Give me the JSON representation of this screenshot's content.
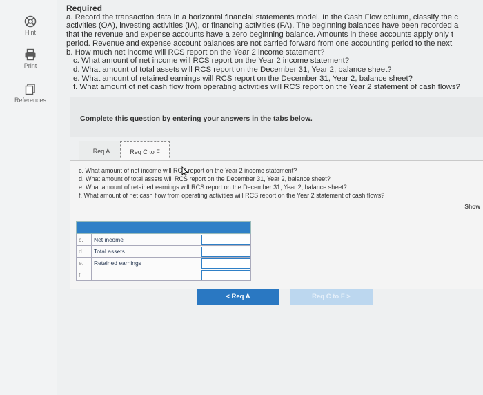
{
  "sidebar": {
    "items": [
      {
        "label": "Hint",
        "icon": "hint-icon"
      },
      {
        "label": "Print",
        "icon": "print-icon"
      },
      {
        "label": "References",
        "icon": "references-icon"
      }
    ]
  },
  "required": {
    "heading": "Required",
    "line_a1": "a. Record the transaction data in a horizontal financial statements model. In the Cash Flow column, classify the c",
    "line_a2": "activities (OA), investing activities (IA), or financing activities (FA). The beginning balances have been recorded a",
    "line_a3": "that the revenue and expense accounts have a zero beginning balance. Amounts in these accounts apply only t",
    "line_a4": "period. Revenue and expense account balances are not carried forward from one accounting period to the next",
    "line_a5": "b. How much net income will RCS report on the Year 2 income statement?",
    "line_c": "c. What amount of net income will RCS report on the Year 2 income statement?",
    "line_d": "d. What amount of total assets will RCS report on the December 31, Year 2, balance sheet?",
    "line_e": "e. What amount of retained earnings will RCS report on the December 31, Year 2, balance sheet?",
    "line_f": "f. What amount of net cash flow from operating activities will RCS report on the Year 2 statement of cash flows?"
  },
  "instruction": "Complete this question by entering your answers in the tabs below.",
  "tabs": [
    {
      "label": "Req A"
    },
    {
      "label": "Req C to F"
    }
  ],
  "questions": {
    "c": "c. What amount of net income will RCS report on the Year 2 income statement?",
    "d": "d. What amount of total assets will RCS report on the December 31, Year 2, balance sheet?",
    "e": "e. What amount of retained earnings will RCS report on the December 31, Year 2, balance sheet?",
    "f": "f. What amount of net cash flow from operating activities will RCS report on the Year 2 statement of cash flows?"
  },
  "show_label": "Show",
  "table": {
    "rows": [
      {
        "letter": "c.",
        "label": "Net income",
        "value": ""
      },
      {
        "letter": "d.",
        "label": "Total assets",
        "value": ""
      },
      {
        "letter": "e.",
        "label": "Retained earnings",
        "value": ""
      },
      {
        "letter": "f.",
        "label": "",
        "value": ""
      }
    ]
  },
  "nav": {
    "prev_label": "< Req A",
    "next_label": "Req C to F >"
  },
  "colors": {
    "accent": "#2a78c2",
    "table_header": "#2f80c7",
    "disabled_button": "#bcd7ef"
  }
}
